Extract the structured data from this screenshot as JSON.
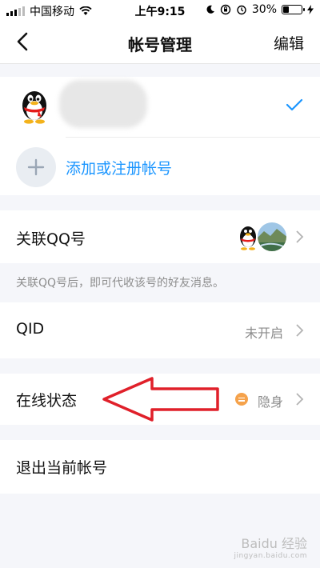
{
  "status_bar": {
    "carrier": "中国移动",
    "time": "上午9:15",
    "battery_percent_text": "30%",
    "battery_level": 0.3
  },
  "nav": {
    "title": "帐号管理",
    "edit_label": "编辑"
  },
  "account": {
    "selected": true,
    "add_label": "添加或注册帐号"
  },
  "linked_qq": {
    "label": "关联QQ号",
    "hint": "关联QQ号后，即可代收该号的好友消息。"
  },
  "qid": {
    "label": "QID",
    "value": "未开启"
  },
  "online_status": {
    "label": "在线状态",
    "value": "隐身",
    "status_color": "#f5a24b"
  },
  "logout": {
    "label": "退出当前帐号"
  },
  "watermark": {
    "text": "Baidu 经验",
    "url": "jingyan.baidu.com"
  },
  "colors": {
    "accent": "#1c96ff",
    "annotation": "#e0202a"
  }
}
